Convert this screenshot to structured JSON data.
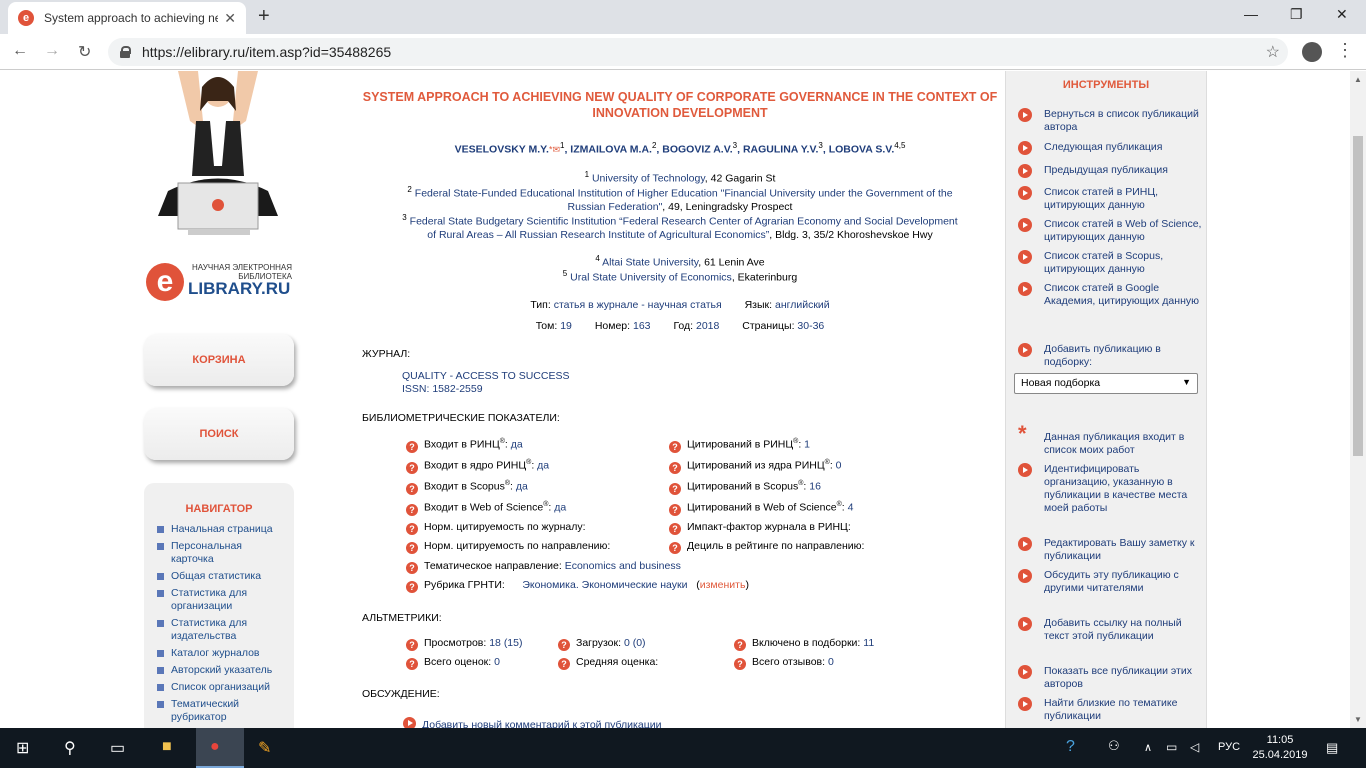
{
  "browser": {
    "tab_title": "System approach to achieving ne",
    "url": "https://elibrary.ru/item.asp?id=35488265"
  },
  "left": {
    "logo_sub": "НАУЧНАЯ ЭЛЕКТРОННАЯ БИБЛИОТЕКА",
    "logo_main": "LIBRARY.RU",
    "logo_letter": "e",
    "cart_label": "КОРЗИНА",
    "search_label": "ПОИСК",
    "navigator_title": "НАВИГАТОР",
    "nav_items": [
      "Начальная страница",
      "Персональная карточка",
      "Общая статистика",
      "Статистика для организации",
      "Статистика для издательства",
      "Каталог журналов",
      "Авторский указатель",
      "Список организаций",
      "Тематический рубрикатор"
    ]
  },
  "article": {
    "title": "SYSTEM APPROACH TO ACHIEVING NEW QUALITY OF CORPORATE GOVERNANCE IN THE CONTEXT OF INNOVATION DEVELOPMENT",
    "authors": [
      {
        "name": "VESELOVSKY M.Y.",
        "sup": "1"
      },
      {
        "name": "IZMAILOVA M.A.",
        "sup": "2"
      },
      {
        "name": "BOGOVIZ A.V.",
        "sup": "3"
      },
      {
        "name": "RAGULINA Y.V.",
        "sup": "3"
      },
      {
        "name": "LOBOVA S.V.",
        "sup": "4,5"
      }
    ],
    "affiliations": [
      {
        "sup": "1",
        "name": "University of Technology",
        "rest": ", 42 Gagarin St"
      },
      {
        "sup": "2",
        "name": "Federal State-Funded Educational Institution of Higher Education \"Financial University under the Government of the Russian Federation\"",
        "rest": ", 49, Leningradsky Prospect"
      },
      {
        "sup": "3",
        "name": "Federal State Budgetary Scientific Institution “Federal Research Center of Agrarian Economy and Social Development of Rural Areas – All Russian Research Institute of Agricultural Economics”",
        "rest": ", Bldg. 3, 35/2 Khoroshevskoe Hwy"
      },
      {
        "sup": "4",
        "name": "Altai State University",
        "rest": ", 61 Lenin Ave"
      },
      {
        "sup": "5",
        "name": "Ural State University of Economics",
        "rest": ", Ekaterinburg"
      }
    ],
    "type_label": "Тип:",
    "type_value": "статья в журнале - научная статья",
    "lang_label": "Язык:",
    "lang_value": "английский",
    "volume_label": "Том:",
    "volume_value": "19",
    "number_label": "Номер:",
    "number_value": "163",
    "year_label": "Год:",
    "year_value": "2018",
    "pages_label": "Страницы:",
    "pages_value": "30-36"
  },
  "journal": {
    "header": "ЖУРНАЛ:",
    "name": "QUALITY - ACCESS TO SUCCESS",
    "issn": "ISSN: 1582-2559"
  },
  "biblio": {
    "header": "БИБЛИОМЕТРИЧЕСКИЕ ПОКАЗАТЕЛИ:",
    "left": [
      {
        "label": "Входит в РИНЦ",
        "reg": "®",
        "sep": ":",
        "value": "да"
      },
      {
        "label": "Входит в ядро РИНЦ",
        "reg": "®",
        "sep": ":",
        "value": "да"
      },
      {
        "label": "Входит в Scopus",
        "reg": "®",
        "sep": ":",
        "value": "да"
      },
      {
        "label": "Входит в Web of Science",
        "reg": "®",
        "sep": ":",
        "value": "да"
      },
      {
        "label": "Норм. цитируемость по журналу:",
        "reg": "",
        "sep": "",
        "value": ""
      },
      {
        "label": "Норм. цитируемость по направлению:",
        "reg": "",
        "sep": "",
        "value": ""
      },
      {
        "label": "Тематическое направление:",
        "reg": "",
        "sep": "",
        "value": "Economics and business"
      },
      {
        "label": "Рубрика ГРНТИ:",
        "reg": "",
        "sep": "",
        "value": "Экономика. Экономические науки"
      }
    ],
    "right": [
      {
        "label": "Цитирований в РИНЦ",
        "reg": "®",
        "sep": ":",
        "value": "1"
      },
      {
        "label": "Цитирований из ядра РИНЦ",
        "reg": "®",
        "sep": ":",
        "value": "0"
      },
      {
        "label": "Цитирований в Scopus",
        "reg": "®",
        "sep": ":",
        "value": "16"
      },
      {
        "label": "Цитирований в Web of Science",
        "reg": "®",
        "sep": ":",
        "value": "4"
      },
      {
        "label": "Импакт-фактор журнала в РИНЦ:",
        "reg": "",
        "sep": "",
        "value": ""
      },
      {
        "label": "Дециль в рейтинге по направлению:",
        "reg": "",
        "sep": "",
        "value": ""
      }
    ],
    "change_label": "изменить"
  },
  "altmetrics": {
    "header": "АЛЬТМЕТРИКИ:",
    "items": [
      {
        "label": "Просмотров:",
        "value": "18 (15)"
      },
      {
        "label": "Загрузок:",
        "value": "0 (0)"
      },
      {
        "label": "Включено в подборки:",
        "value": "11"
      },
      {
        "label": "Всего оценок:",
        "value": "0"
      },
      {
        "label": "Средняя оценка:",
        "value": ""
      },
      {
        "label": "Всего отзывов:",
        "value": "0"
      }
    ]
  },
  "discussion": {
    "header": "ОБСУЖДЕНИЕ:",
    "add_comment": "Добавить новый комментарий к этой публикации"
  },
  "tools": {
    "title": "ИНСТРУМЕНТЫ",
    "items": [
      "Вернуться в список публикаций автора",
      "Следующая публикация",
      "Предыдущая публикация",
      "Список статей в РИНЦ, цитирующих данную",
      "Список статей в Web of Science, цитирующих данную",
      "Список статей в Scopus, цитирующих данную",
      "Список статей в Google Академия, цитирующих данную",
      "Добавить публикацию в подборку:"
    ],
    "collection_select": "Новая подборка",
    "items2": [
      "Данная публикация входит в список моих работ",
      "Идентифицировать организацию, указанную в публикации в качестве места моей работы",
      "Редактировать Вашу заметку к публикации",
      "Обсудить эту публикацию с другими читателями",
      "Добавить ссылку на полный текст этой публикации",
      "Показать все публикации этих авторов",
      "Найти близкие по тематике публикации"
    ]
  },
  "taskbar": {
    "lang": "РУС",
    "time": "11:05",
    "date": "25.04.2019"
  }
}
